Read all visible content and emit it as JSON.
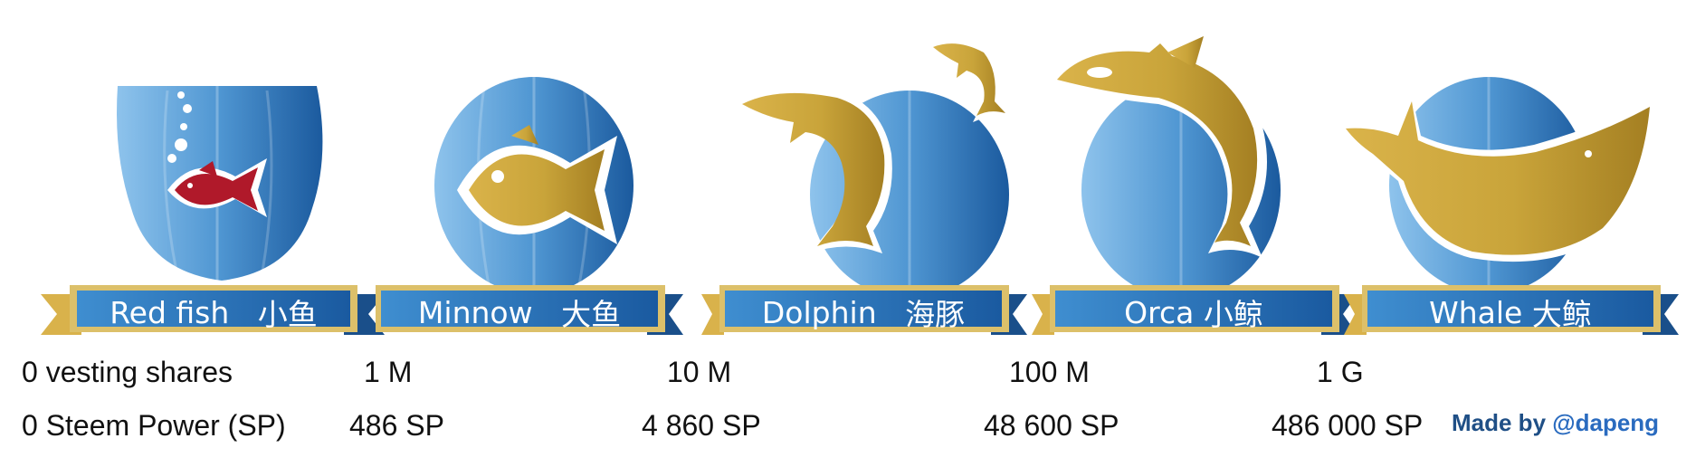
{
  "tiers": [
    {
      "name": "Red fish",
      "name_cn": "小鱼",
      "vests": "0 vesting shares",
      "sp": "0 Steem Power (SP)",
      "icon": "red-fish-in-fishbowl"
    },
    {
      "name": "Minnow",
      "name_cn": "大鱼",
      "vests": "1 M",
      "sp": "486 SP",
      "icon": "fish-icon"
    },
    {
      "name": "Dolphin",
      "name_cn": "海豚",
      "vests": "10 M",
      "sp": "4 860 SP",
      "icon": "dolphin-icon"
    },
    {
      "name": "Orca",
      "name_cn": "小鲸",
      "vests": "100 M",
      "sp": "48 600 SP",
      "icon": "orca-icon"
    },
    {
      "name": "Whale",
      "name_cn": "大鲸",
      "vests": "1 G",
      "sp": "486 000 SP",
      "icon": "whale-icon"
    }
  ],
  "credit": {
    "prefix": "Made by ",
    "handle": "@dapeng"
  },
  "colors": {
    "gold": "#c9a43a",
    "blue_dark": "#1e5a9c",
    "blue_light": "#5aa3dc",
    "red_fish": "#b0192a",
    "credit_blue": "#1f4f86"
  }
}
